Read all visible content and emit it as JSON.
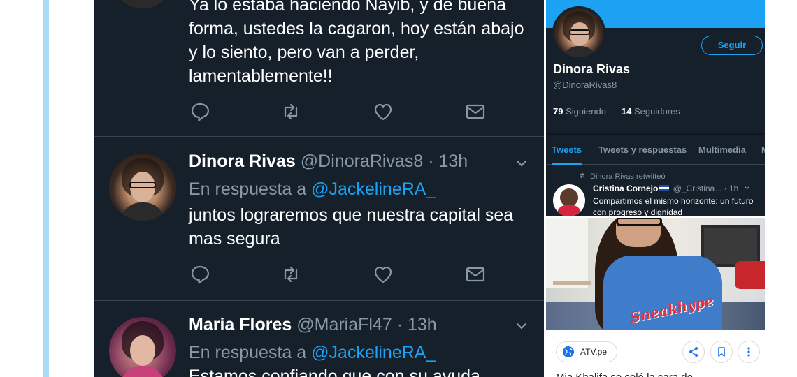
{
  "colors": {
    "feed_bg": "#15202b",
    "accent": "#1da1f2",
    "muted": "#8899a6",
    "divider": "#38444d"
  },
  "tweets": [
    {
      "text": "Ya lo estaba haciendo Nayib, y de buena forma, ustedes la cagaron, hoy están abajo y lo siento, pero van a perder, lamentablemente!!",
      "actions": [
        "reply-icon",
        "retweet-icon",
        "like-icon",
        "message-icon"
      ]
    },
    {
      "name": "Dinora Rivas",
      "handle": "@DinoraRivas8",
      "time": "· 13h",
      "reply_prefix": "En respuesta a",
      "reply_to": "@JackelineRA_",
      "text": "juntos lograremos que nuestra capital sea mas segura",
      "actions": [
        "reply-icon",
        "retweet-icon",
        "like-icon",
        "message-icon"
      ]
    },
    {
      "name": "Maria Flores",
      "handle": "@MariaFl47",
      "time": "· 13h",
      "reply_prefix": "En respuesta a",
      "reply_to": "@JackelineRA_",
      "text": "Estamos confiando que con su ayuda"
    }
  ],
  "profile": {
    "follow_label": "Seguir",
    "name": "Dinora Rivas",
    "handle": "@DinoraRivas8",
    "following_count": "79",
    "following_label": "Siguiendo",
    "followers_count": "14",
    "followers_label": "Seguidores",
    "tabs": [
      {
        "label": "Tweets",
        "active": true
      },
      {
        "label": "Tweets y respuestas",
        "active": false
      },
      {
        "label": "Multimedia",
        "active": false
      },
      {
        "label": "M",
        "active": false
      }
    ],
    "retweet": {
      "context": "Dinora Rivas retwitteó",
      "name": "Cristina Cornejo",
      "handle": "@_Cristina...",
      "time": "· 1h",
      "text": "Compartimos el mismo horizonte: un futuro con progreso y dignidad"
    }
  },
  "photo": {
    "shirt_text": "Sneakhype"
  },
  "article": {
    "source": "ATV.pe",
    "title": "Mia Khalifa se coló la cara de"
  }
}
